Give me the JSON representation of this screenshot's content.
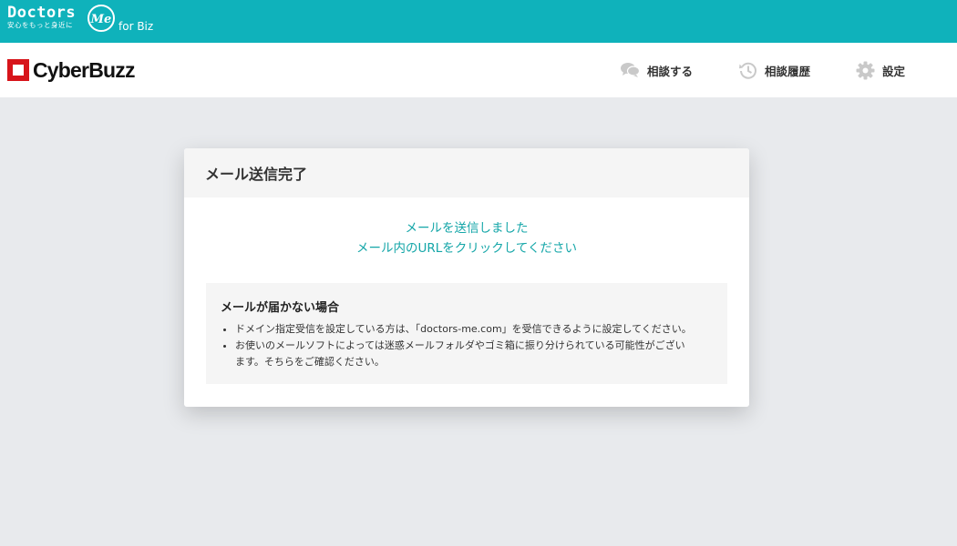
{
  "topbar": {
    "brand_name": "Doctors",
    "brand_me": "Me",
    "brand_tagline": "安心をもっと身近に",
    "brand_suffix": "for Biz",
    "background": "#0fb2bb"
  },
  "header": {
    "company_logo": "CyberBuzz",
    "nav": [
      {
        "label": "相談する",
        "icon": "chat-bubbles-icon"
      },
      {
        "label": "相談履歴",
        "icon": "history-clock-icon"
      },
      {
        "label": "設定",
        "icon": "gear-icon"
      }
    ]
  },
  "card": {
    "title": "メール送信完了",
    "message_line1": "メールを送信しました",
    "message_line2": "メール内のURLをクリックしてください",
    "notice": {
      "title": "メールが届かない場合",
      "items": [
        "ドメイン指定受信を設定している方は、「doctors-me.com」を受信できるように設定してください。",
        "お使いのメールソフトによっては迷惑メールフォルダやゴミ箱に振り分けられている可能性がございます。そちらをご確認ください。"
      ]
    }
  },
  "colors": {
    "accent": "#14a6a8",
    "logo_red": "#d7141a",
    "page_bg": "#e8eaed"
  }
}
